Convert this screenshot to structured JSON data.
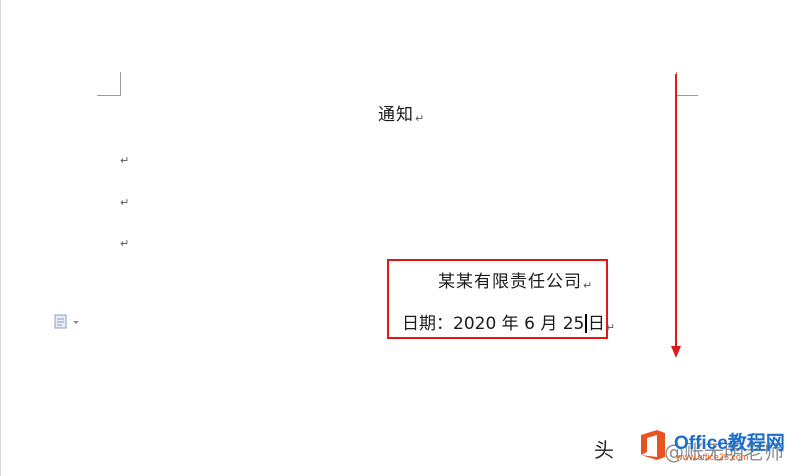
{
  "document": {
    "title": "通知",
    "paragraph_mark": "↵",
    "empty_paragraph_count": 3,
    "signature": {
      "company": "某某有限责任公司",
      "date_label": "日期：",
      "date_year": "2020",
      "date_year_unit": "年",
      "date_month": "6",
      "date_month_unit": "月",
      "date_day": "25",
      "date_day_unit": "日"
    }
  },
  "paste_options": {
    "icon": "paste-options-icon",
    "dropdown_icon": "chevron-down-icon"
  },
  "annotations": {
    "highlight_color": "#e01818",
    "arrow_direction": "down",
    "arrow_color": "#e01818"
  },
  "watermark": {
    "left_text": "头",
    "brand": "Office教程网",
    "url": "www.office26.com",
    "trailing_text": "@账无明老师",
    "logo_color": "#e8541e"
  }
}
